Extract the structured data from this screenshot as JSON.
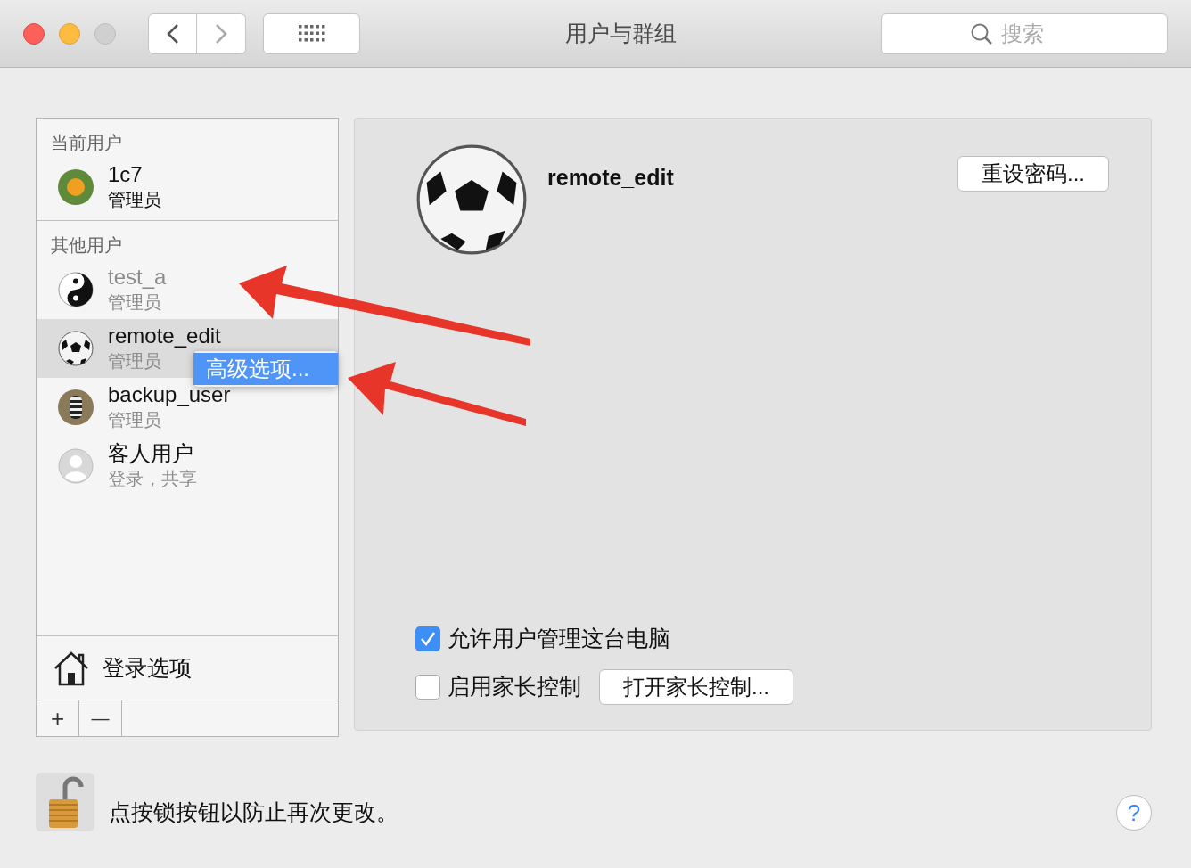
{
  "window": {
    "title": "用户与群组"
  },
  "search": {
    "placeholder": "搜索"
  },
  "user_list": {
    "sections": [
      {
        "heading": "当前用户",
        "users": [
          {
            "name": "1c7",
            "role": "管理员",
            "kind": "flower",
            "selected": false,
            "disabled": false
          }
        ]
      },
      {
        "heading": "其他用户",
        "users": [
          {
            "name": "test_a",
            "role": "管理员",
            "kind": "yinyang",
            "selected": false,
            "disabled": true
          },
          {
            "name": "remote_edit",
            "role": "管理员",
            "kind": "ball",
            "selected": true,
            "disabled": false
          },
          {
            "name": "backup_user",
            "role": "管理员",
            "kind": "zebra",
            "selected": false,
            "disabled": false
          },
          {
            "name": "客人用户",
            "role": "登录，共享",
            "kind": "guest",
            "selected": false,
            "disabled": false
          }
        ]
      }
    ],
    "login_options": "登录选项",
    "add": "+",
    "remove": "—"
  },
  "context_menu": {
    "items": [
      {
        "label": "高级选项...",
        "selected": true
      }
    ]
  },
  "details": {
    "name": "remote_edit",
    "reset_button": "重设密码...",
    "options": [
      {
        "label": "允许用户管理这台电脑",
        "checked": true
      },
      {
        "label": "启用家长控制",
        "checked": false
      }
    ],
    "parental_button": "打开家长控制..."
  },
  "footer": {
    "lock_text": "点按锁按钮以防止再次更改。",
    "help": "?"
  }
}
